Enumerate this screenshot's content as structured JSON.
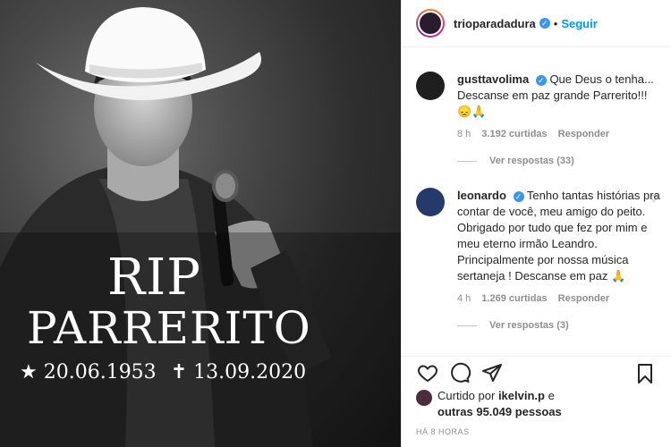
{
  "media": {
    "title": "RIP",
    "name": "PARRERITO",
    "birth": "★ 20.06.1953",
    "death": "✝ 13.09.2020"
  },
  "header": {
    "username": "trioparadadura",
    "separator": "•",
    "follow_label": "Seguir"
  },
  "comments": [
    {
      "username": "gusttavolima",
      "text": "Que Deus o tenha... Descanse em paz grande Parrerito!!! 😞🙏",
      "time": "8 h",
      "likes": "3.192 curtidas",
      "reply": "Responder",
      "view_replies": "Ver respostas (33)"
    },
    {
      "username": "leonardo",
      "text": "Tenho tantas histórias pra contar de você, meu amigo do peito. Obrigado por tudo que fez por mim e meu eterno irmão Leandro. Principalmente por nossa música sertaneja ! Descanse em paz 🙏",
      "time": "4 h",
      "likes": "1.269 curtidas",
      "reply": "Responder",
      "view_replies": "Ver respostas (3)"
    }
  ],
  "likes": {
    "prefix": "Curtido por",
    "user": "ikelvin.p",
    "mid": "e",
    "others": "outras 95.049 pessoas"
  },
  "timestamp": "HÁ 8 HORAS",
  "colors": {
    "link": "#0095f6",
    "verified": "#3897f0",
    "muted": "#8e8e8e"
  }
}
